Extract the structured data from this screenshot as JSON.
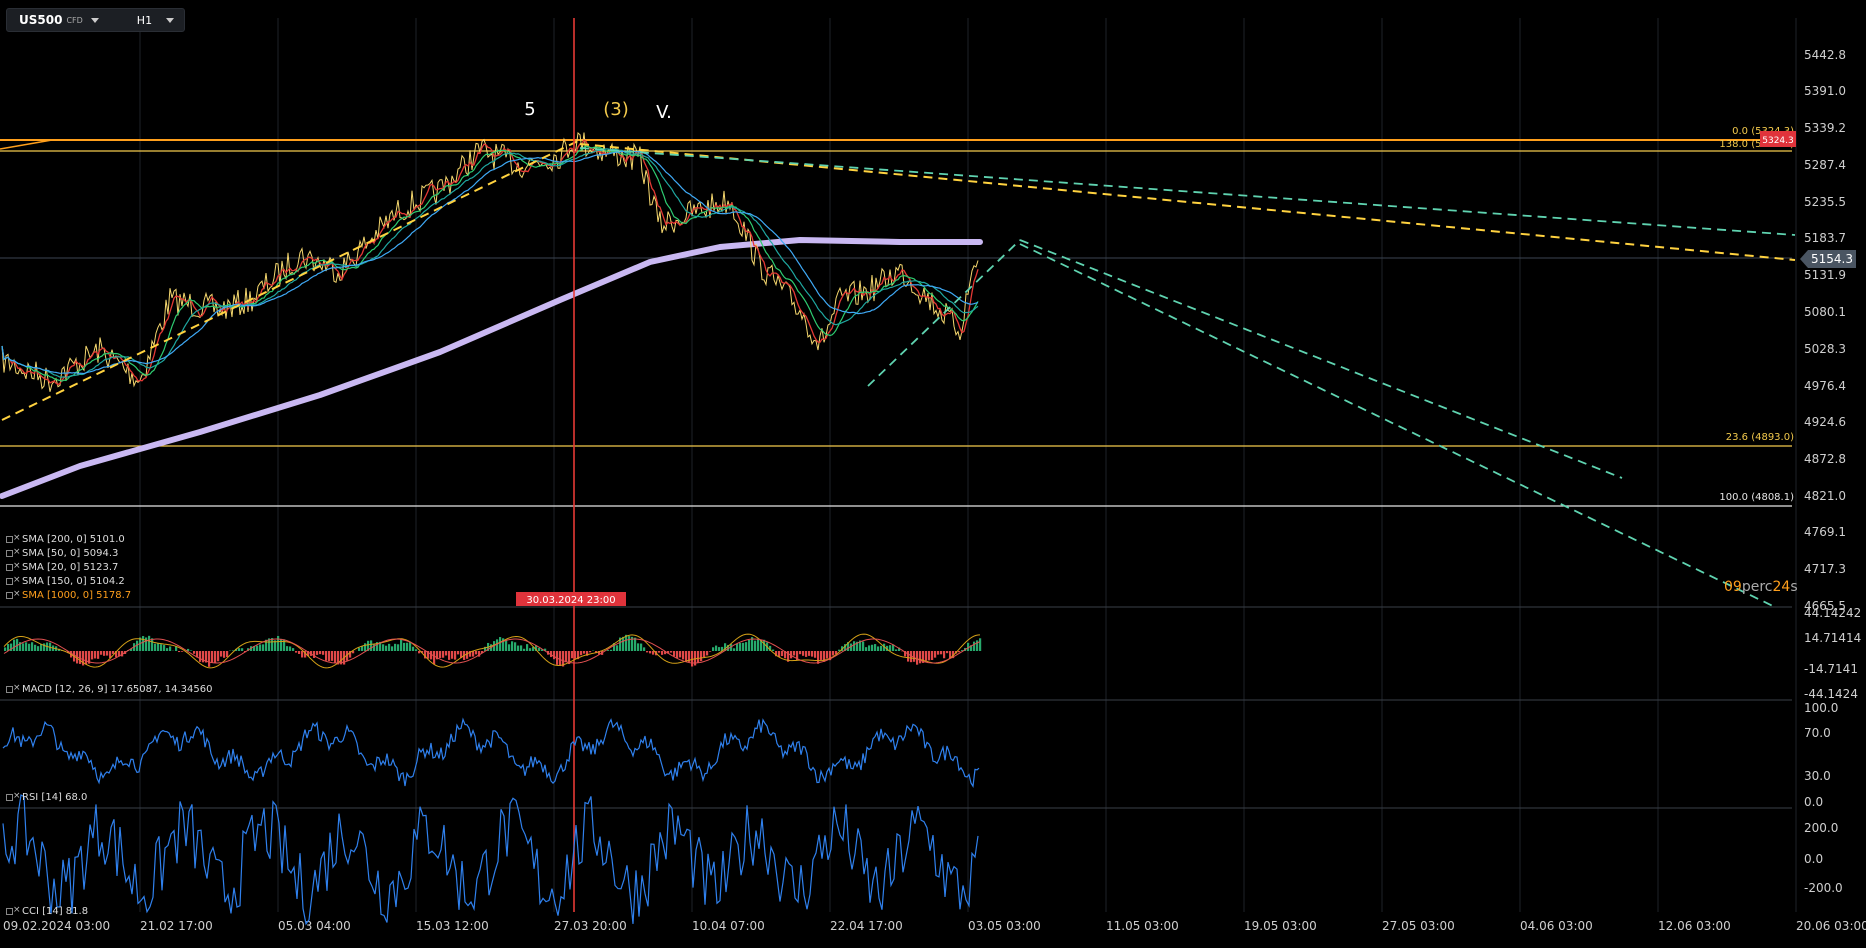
{
  "symbol": {
    "name": "US500",
    "tag": "CFD",
    "timeframe": "H1"
  },
  "price_axis": {
    "labels": [
      "5442.8",
      "5391.0",
      "5339.2",
      "5287.4",
      "5235.5",
      "5183.7",
      "5131.9",
      "5080.1",
      "5028.3",
      "4976.4",
      "4924.6",
      "4872.8",
      "4821.0",
      "4769.1",
      "4717.3",
      "4665.5"
    ],
    "current_price": "5154.3",
    "current_alt": "5324.3"
  },
  "time_axis": [
    "09.02.2024  03:00",
    "21.02  17:00",
    "05.03  04:00",
    "15.03  12:00",
    "27.03  20:00",
    "10.04  07:00",
    "22.04  17:00",
    "03.05  03:00",
    "11.05  03:00",
    "19.05  03:00",
    "27.05  03:00",
    "04.06  03:00",
    "12.06  03:00",
    "20.06  03:00"
  ],
  "crosshair_time": "30.03.2024  23:00",
  "wave_labels": [
    "5",
    "(3)",
    "V."
  ],
  "fib_levels": [
    {
      "label": "0.0 (5324.3)"
    },
    {
      "label": "138.0 (5307.2)"
    },
    {
      "label": "23.6 (4893.0)"
    },
    {
      "label": "100.0 (4808.1)"
    }
  ],
  "countdown": {
    "value": "09",
    "unit1": "perc",
    "value2": "24",
    "unit2": "s"
  },
  "sma_legend": [
    {
      "text": "SMA [200,  0]  5101.0"
    },
    {
      "text": "SMA [50,  0]  5094.3"
    },
    {
      "text": "SMA [20,  0]  5123.7"
    },
    {
      "text": "SMA [150,  0]  5104.2"
    },
    {
      "text": "SMA [1000,  0]  5178.7"
    }
  ],
  "macd": {
    "legend": "MACD [12,  26,  9]  17.65087,   14.34560",
    "axis": [
      "44.14242",
      "14.71414",
      "-14.7141",
      "-44.1424"
    ]
  },
  "rsi": {
    "legend": "RSI [14]  68.0",
    "axis": [
      "100.0",
      "70.0",
      "30.0",
      "0.0"
    ]
  },
  "cci": {
    "legend": "CCI [14]  81.8",
    "axis": [
      "200.0",
      "0.0",
      "-200.0"
    ]
  },
  "colors": {
    "bg": "#000000",
    "fib": "#f2c94c",
    "orange": "#ff9f1c",
    "cross": "#e53935",
    "sma1000": "#c9b8f2",
    "dash_yellow": "#ffd23f",
    "dash_teal": "#5fd3b0",
    "macd_pos": "#26a96c",
    "macd_neg": "#e04848",
    "rsi": "#2f80ed",
    "label_red": "#e0333b",
    "price_tag": "#4a5562"
  }
}
